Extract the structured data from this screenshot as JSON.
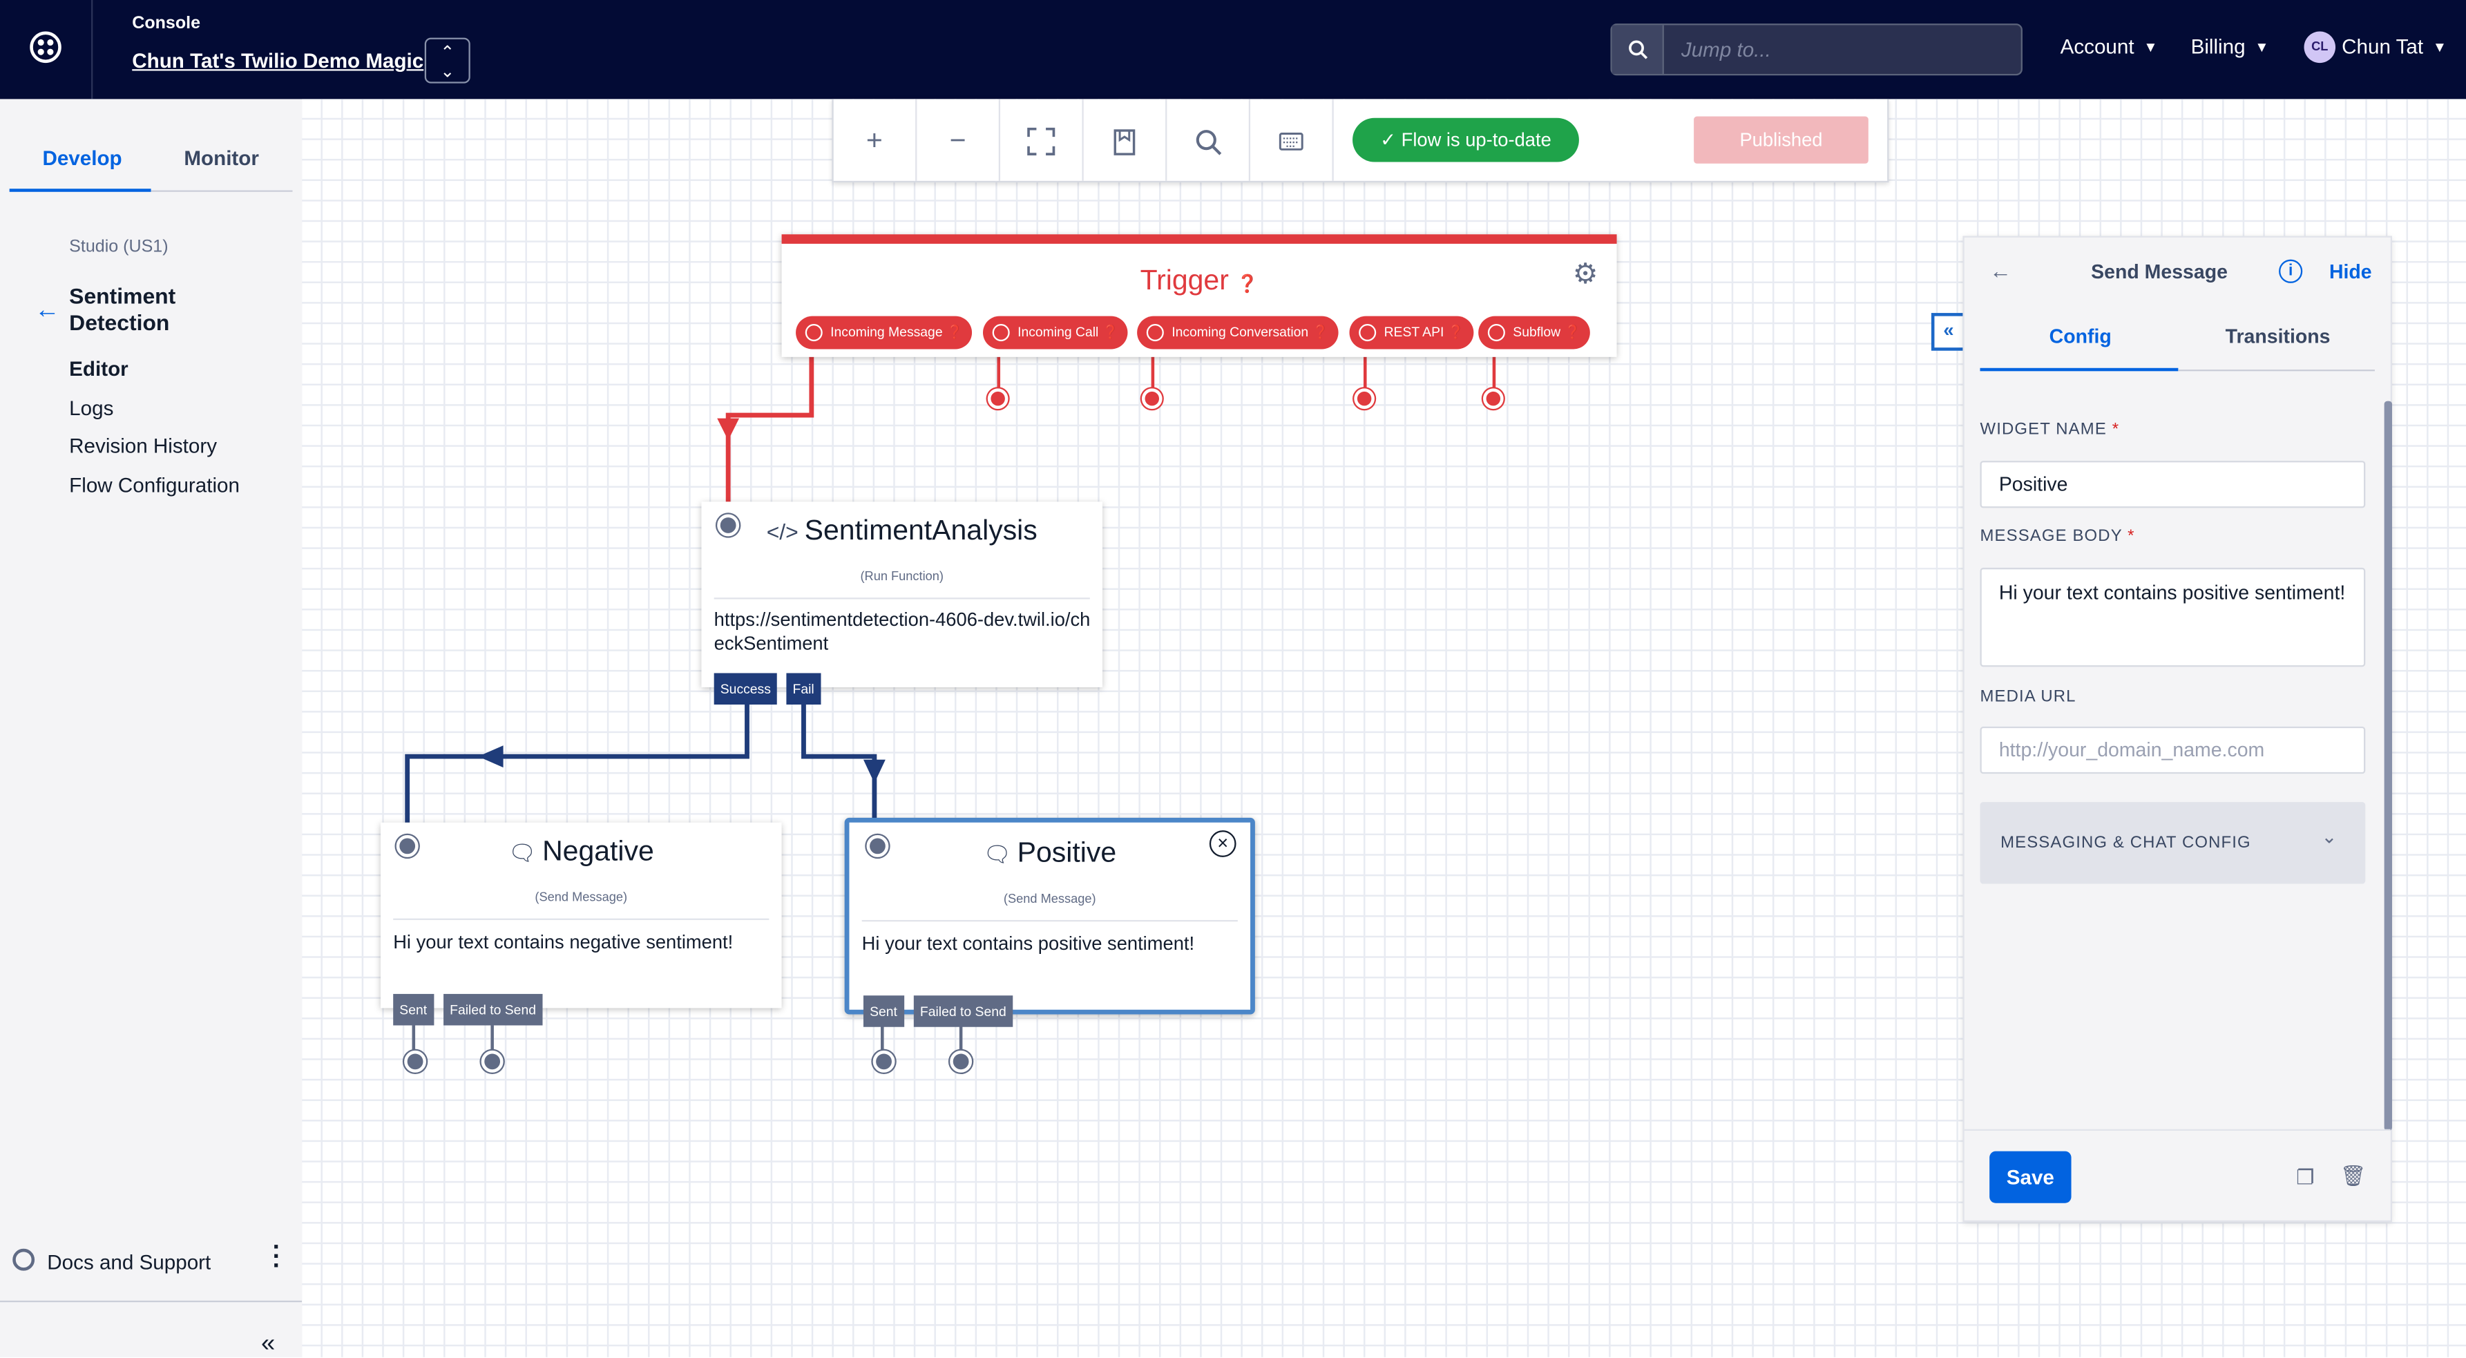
{
  "header": {
    "console_label": "Console",
    "account_name": "Chun Tat's Twilio Demo Magic",
    "search_placeholder": "Jump to...",
    "menus": {
      "account": "Account",
      "billing": "Billing",
      "user": "Chun Tat"
    },
    "avatar_initials": "CL"
  },
  "sidebar": {
    "tabs": [
      "Develop",
      "Monitor"
    ],
    "active_tab": "Develop",
    "region": "Studio (US1)",
    "flow_name": "Sentiment Detection",
    "items": [
      "Editor",
      "Logs",
      "Revision History",
      "Flow Configuration"
    ],
    "active_item": "Editor",
    "docs_label": "Docs and Support"
  },
  "toolbar": {
    "status": "Flow is up-to-date",
    "status_color": "#1fa34a",
    "publish_label": "Published",
    "icons": [
      "zoom-in-icon",
      "zoom-out-icon",
      "fit-screen-icon",
      "bookmark-icon",
      "search-icon",
      "keyboard-icon"
    ]
  },
  "trigger": {
    "title": "Trigger",
    "pills": [
      "Incoming Message",
      "Incoming Call",
      "Incoming Conversation",
      "REST API",
      "Subflow"
    ],
    "accent": "#e03a3e"
  },
  "widgets": {
    "sentiment": {
      "title": "SentimentAnalysis",
      "subtitle": "(Run Function)",
      "body": "https://sentimentdetection-4606-dev.twil.io/checkSentiment",
      "transitions": [
        "Success",
        "Fail"
      ]
    },
    "negative": {
      "title": "Negative",
      "subtitle": "(Send Message)",
      "body": "Hi your text contains negative sentiment!",
      "transitions": [
        "Sent",
        "Failed to Send"
      ]
    },
    "positive": {
      "title": "Positive",
      "subtitle": "(Send Message)",
      "body": "Hi your text contains positive sentiment!",
      "transitions": [
        "Sent",
        "Failed to Send"
      ],
      "selected": true
    }
  },
  "panel": {
    "title": "Send Message",
    "hide_label": "Hide",
    "tabs": [
      "Config",
      "Transitions"
    ],
    "active_tab": "Config",
    "widget_name_label": "WIDGET NAME",
    "widget_name_value": "Positive",
    "message_body_label": "MESSAGE BODY",
    "message_body_value": "Hi your text contains positive sentiment!",
    "media_url_label": "MEDIA URL",
    "media_url_placeholder": "http://your_domain_name.com",
    "chat_config_label": "MESSAGING & CHAT CONFIG",
    "save_label": "Save",
    "required_mark": "*"
  }
}
